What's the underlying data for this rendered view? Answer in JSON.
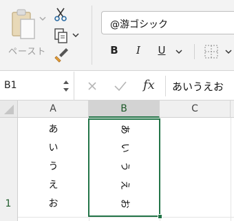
{
  "ribbon": {
    "paste_label": "ペースト",
    "font_name": "@游ゴシック",
    "bold_label": "B",
    "italic_label": "I",
    "underline_label": "U"
  },
  "formula_bar": {
    "name_box": "B1",
    "fx_label": "fx",
    "content": "あいうえお"
  },
  "grid": {
    "columns": [
      "A",
      "B",
      "C"
    ],
    "row_numbers": [
      "1"
    ],
    "column_a": [
      "あ",
      "い",
      "う",
      "え",
      "お"
    ],
    "column_b": [
      "あ",
      "い",
      "う",
      "え",
      "お"
    ]
  },
  "colors": {
    "selection_accent": "#217346",
    "ribbon_bg": "#f3f3f3"
  },
  "icons": [
    "paste-icon",
    "cut-icon",
    "copy-icon",
    "format-painter-icon",
    "borders-icon",
    "cancel-icon",
    "enter-icon",
    "fx-icon"
  ]
}
